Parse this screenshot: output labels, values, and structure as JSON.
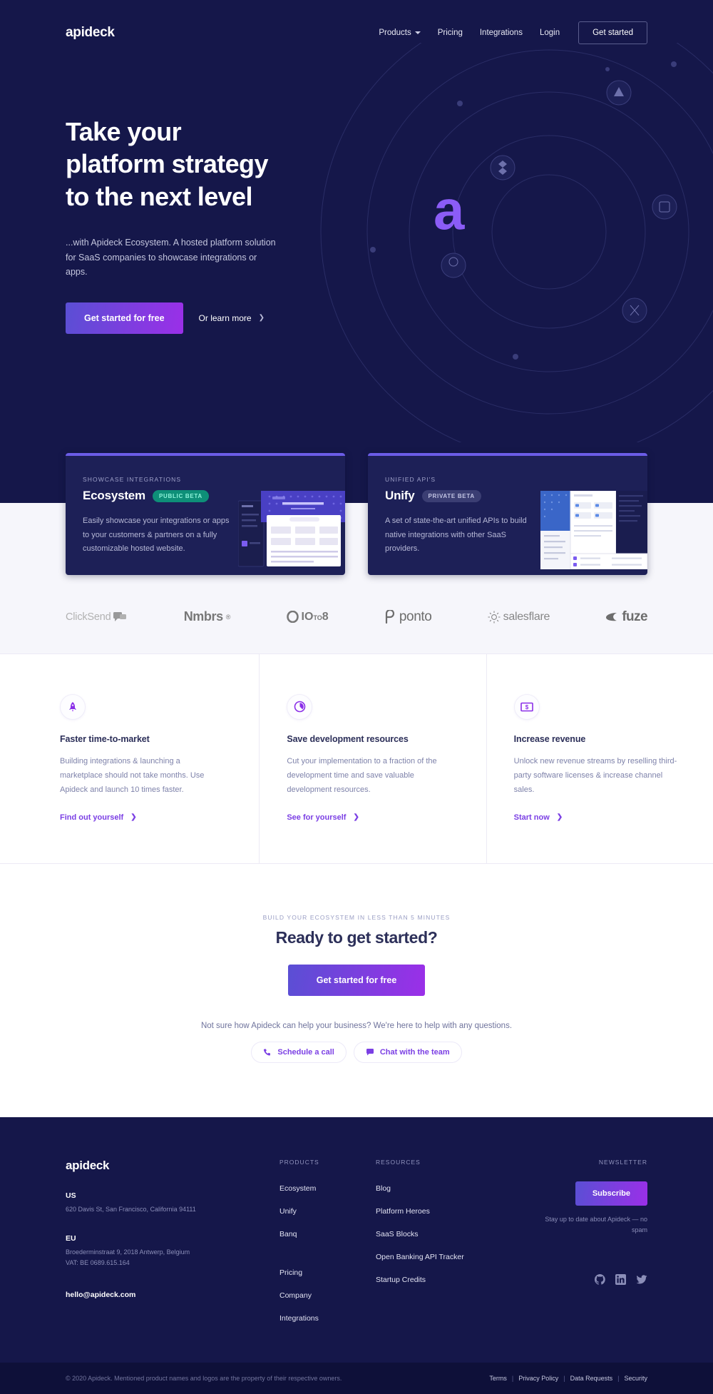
{
  "brand": {
    "name": "apideck"
  },
  "nav": {
    "items": [
      {
        "label": "Products",
        "has_caret": true
      },
      {
        "label": "Pricing",
        "has_caret": false
      },
      {
        "label": "Integrations",
        "has_caret": false
      },
      {
        "label": "Login",
        "has_caret": false
      }
    ],
    "cta": "Get started"
  },
  "hero": {
    "title_line1": "Take your",
    "title_line2": "platform strategy",
    "title_line3": "to the next level",
    "subtitle": "...with Apideck Ecosystem. A hosted platform solution for SaaS companies to showcase integrations or apps.",
    "primary_cta": "Get started for free",
    "secondary_cta": "Or learn more",
    "center_glyph": "a"
  },
  "product_cards": [
    {
      "eyebrow": "SHOWCASE INTEGRATIONS",
      "title": "Ecosystem",
      "badge": "PUBLIC BETA",
      "badge_kind": "public",
      "description": "Easily showcase your integrations or apps to your customers & partners on a fully customizable hosted website."
    },
    {
      "eyebrow": "UNIFIED API'S",
      "title": "Unify",
      "badge": "PRIVATE BETA",
      "badge_kind": "private",
      "description": "A set of state-the-art unified APIs to build native integrations with other SaaS providers."
    }
  ],
  "logos": [
    {
      "name": "ClickSend",
      "icon": "speech-bubbles-icon"
    },
    {
      "name": "Nmbrs",
      "icon": "registered-mark-icon"
    },
    {
      "name": "10to8",
      "icon": "ring-icon"
    },
    {
      "name": "ponto",
      "icon": "p-mark-icon"
    },
    {
      "name": "salesflare",
      "icon": "sunburst-icon"
    },
    {
      "name": "fuze",
      "icon": "fuze-drop-icon"
    }
  ],
  "features": [
    {
      "icon": "rocket-icon",
      "title": "Faster time-to-market",
      "body": "Building integrations & launching a marketplace should not take months. Use Apideck and launch 10 times faster.",
      "link": "Find out yourself"
    },
    {
      "icon": "clock-icon",
      "title": "Save development resources",
      "body": "Cut your implementation to a fraction of the development time and save valuable development resources.",
      "link": "See for yourself"
    },
    {
      "icon": "banknote-icon",
      "title": "Increase revenue",
      "body": "Unlock new revenue streams by reselling third-party software licenses & increase channel sales.",
      "link": "Start now"
    }
  ],
  "cta": {
    "eyebrow": "BUILD YOUR ECOSYSTEM IN LESS THAN 5 MINUTES",
    "heading": "Ready to get started?",
    "button": "Get started for free",
    "note": "Not sure how Apideck can help your business? We're here to help with any questions.",
    "pills": [
      {
        "label": "Schedule a call",
        "icon": "phone-icon"
      },
      {
        "label": "Chat with the team",
        "icon": "chat-icon"
      }
    ]
  },
  "footer": {
    "logo": "apideck",
    "offices": [
      {
        "label": "US",
        "address": "620 Davis St, San Francisco, California 94111"
      },
      {
        "label": "EU",
        "address": "Broederminstraat 9, 2018 Antwerp, Belgium\nVAT: BE 0689.615.164"
      }
    ],
    "email": "hello@apideck.com",
    "products_head": "PRODUCTS",
    "products": [
      "Ecosystem",
      "Unify",
      "Banq"
    ],
    "products_extra": [
      "Pricing",
      "Company",
      "Integrations"
    ],
    "resources_head": "RESOURCES",
    "resources": [
      "Blog",
      "Platform Heroes",
      "SaaS Blocks",
      "Open Banking API Tracker",
      "Startup Credits"
    ],
    "newsletter_head": "NEWSLETTER",
    "subscribe": "Subscribe",
    "subscribe_note": "Stay up to date about Apideck — no spam",
    "socials": [
      "github-icon",
      "linkedin-icon",
      "twitter-icon"
    ],
    "copyright": "© 2020 Apideck. Mentioned product names and logos are the property of their respective owners.",
    "legal_links": [
      "Terms",
      "Privacy Policy",
      "Data Requests",
      "Security"
    ]
  },
  "colors": {
    "hero_bg": "#15174a",
    "card_bg": "#1d2057",
    "accent_purple": "#7b3fe4",
    "gradient_start": "#5a4fd4",
    "gradient_end": "#9b2fe8",
    "badge_public": "#0e8f78",
    "band_bg": "#f6f6fb",
    "bottom_bar": "#0e1039"
  }
}
